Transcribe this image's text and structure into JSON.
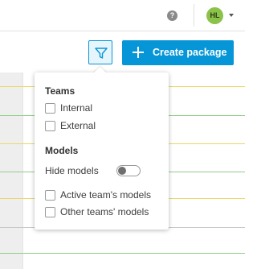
{
  "header": {
    "help_icon": "help-icon",
    "help_glyph": "?",
    "avatar_initials": "HL",
    "avatar_color": "#8bc34a"
  },
  "toolbar": {
    "filter_icon": "filter-icon",
    "create_label": "Create package",
    "accent_color": "#0696d7"
  },
  "filter_popover": {
    "teams_title": "Teams",
    "teams_options": [
      {
        "label": "Internal",
        "checked": false
      },
      {
        "label": "External",
        "checked": false
      }
    ],
    "models_title": "Models",
    "hide_models_label": "Hide models",
    "hide_models_on": false,
    "models_options": [
      {
        "label": "Active team's models",
        "checked": false
      },
      {
        "label": "Other teams' models",
        "checked": false
      }
    ]
  }
}
